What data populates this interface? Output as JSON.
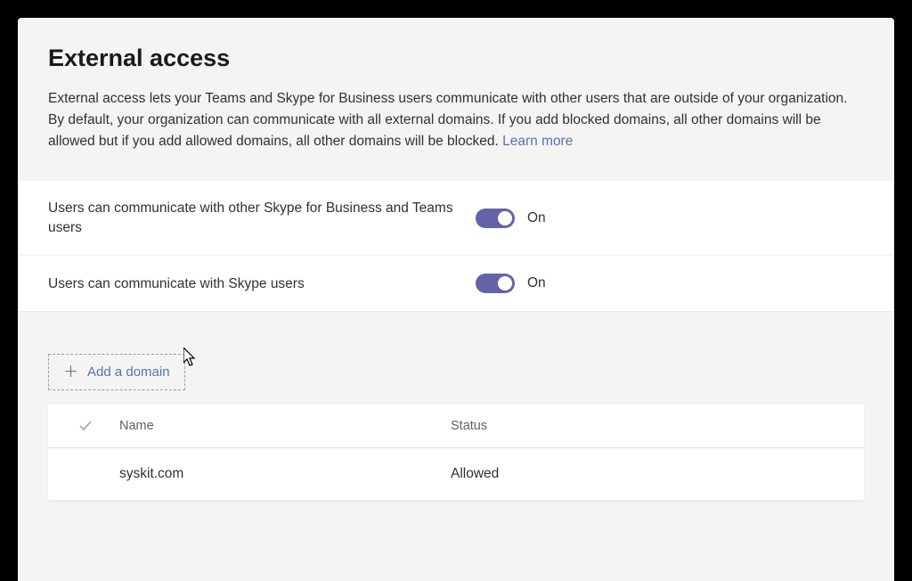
{
  "header": {
    "title": "External access",
    "description": "External access lets your Teams and Skype for Business users communicate with other users that are outside of your organization. By default, your organization can communicate with all external domains. If you add blocked domains, all other domains will be allowed but if you add allowed domains, all other domains will be blocked. ",
    "learn_more": "Learn more"
  },
  "settings": [
    {
      "label": "Users can communicate with other Skype for Business and Teams users",
      "state": "On"
    },
    {
      "label": "Users can communicate with Skype users",
      "state": "On"
    }
  ],
  "domains": {
    "add_label": "Add a domain",
    "columns": {
      "name": "Name",
      "status": "Status"
    },
    "rows": [
      {
        "name": "syskit.com",
        "status": "Allowed"
      }
    ]
  }
}
